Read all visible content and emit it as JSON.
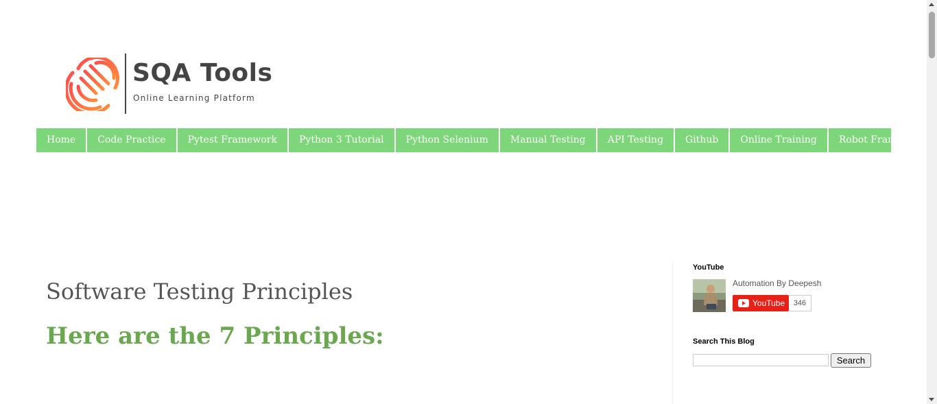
{
  "logo": {
    "title": "SQA Tools",
    "subtitle": "Online Learning Platform"
  },
  "nav": {
    "items": [
      {
        "label": "Home"
      },
      {
        "label": "Code Practice"
      },
      {
        "label": "Pytest Framework"
      },
      {
        "label": "Python 3 Tutorial"
      },
      {
        "label": "Python Selenium"
      },
      {
        "label": "Manual Testing"
      },
      {
        "label": "API Testing"
      },
      {
        "label": "Github"
      },
      {
        "label": "Online Training"
      },
      {
        "label": "Robot Framework"
      }
    ]
  },
  "post": {
    "title": "Software Testing Principles",
    "heading": "Here are the 7 Principles:"
  },
  "sidebar": {
    "youtube": {
      "widget_title": "YouTube",
      "channel_name": "Automation By Deepesh",
      "button_label": "YouTube",
      "subscriber_count": "346"
    },
    "search": {
      "widget_title": "Search This Blog",
      "input_value": "",
      "button_label": "Search"
    }
  },
  "colors": {
    "nav_bg": "#7ed67a",
    "heading_green": "#6aa84f",
    "youtube_red": "#e62117",
    "logo_gradient_start": "#ff5a4d",
    "logo_gradient_end": "#ff8a3d"
  }
}
